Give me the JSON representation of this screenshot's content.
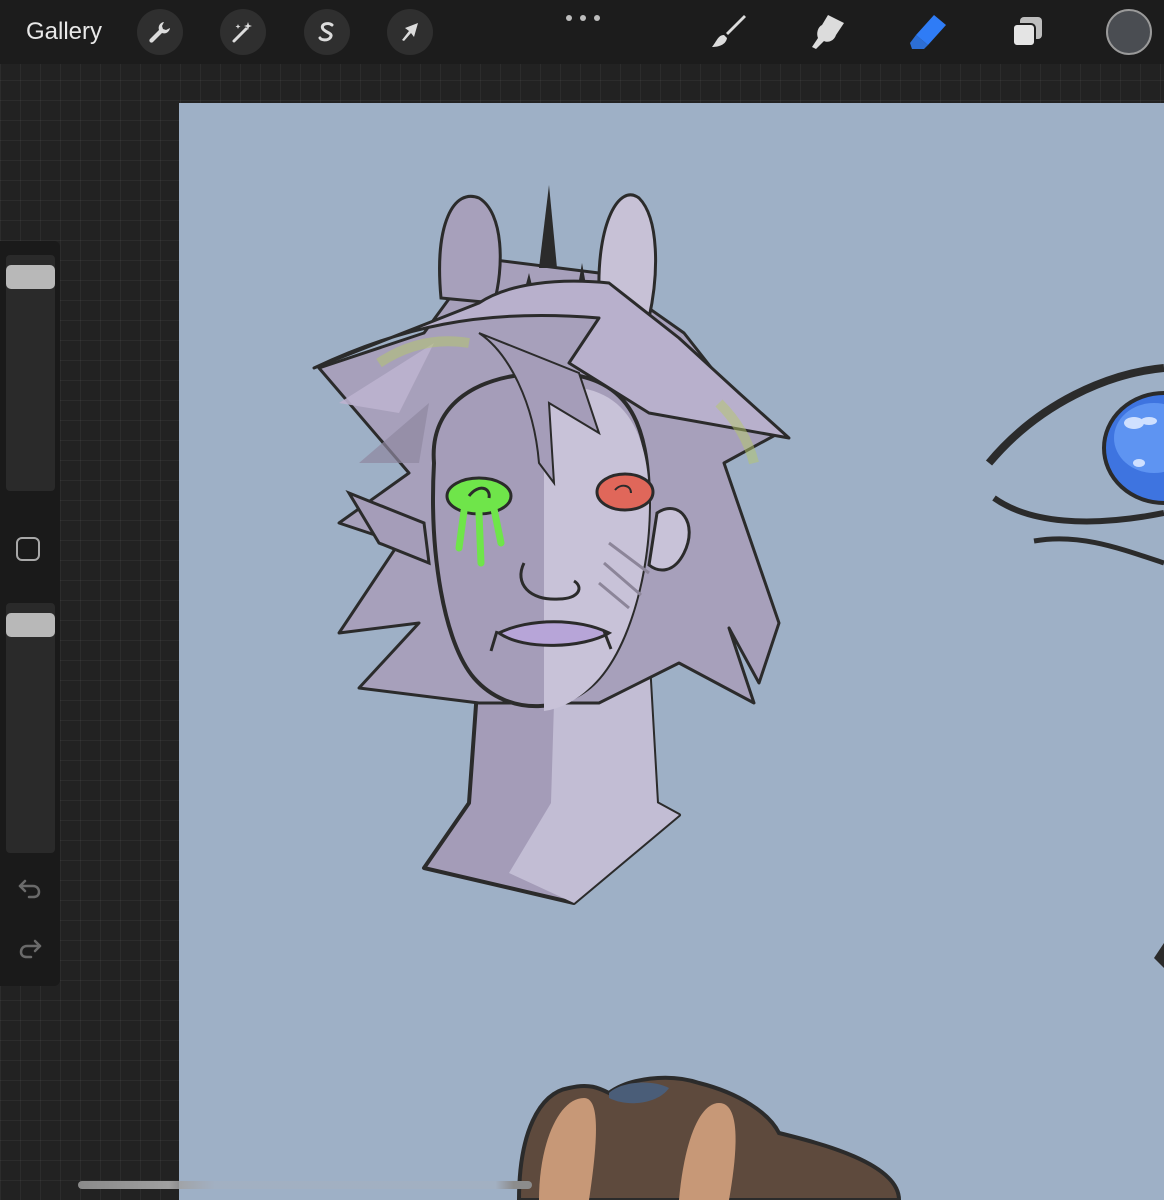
{
  "toolbar": {
    "gallery_label": "Gallery",
    "left_tools": [
      "wrench-icon",
      "magic-wand-icon",
      "selection-s-icon",
      "transform-arrow-icon"
    ],
    "right_tools": [
      "brush-icon",
      "smudge-icon",
      "eraser-icon",
      "layers-icon"
    ],
    "active_tool": "eraser",
    "active_color": "#2f7cf6",
    "current_color": "#4a4d52"
  },
  "canvas": {
    "background_color": "#9eb0c6"
  },
  "sidebar": {
    "brush_size_level": 0.0,
    "opacity_level": 0.0,
    "icons": [
      "modify-square-icon",
      "undo-icon",
      "redo-icon"
    ]
  }
}
